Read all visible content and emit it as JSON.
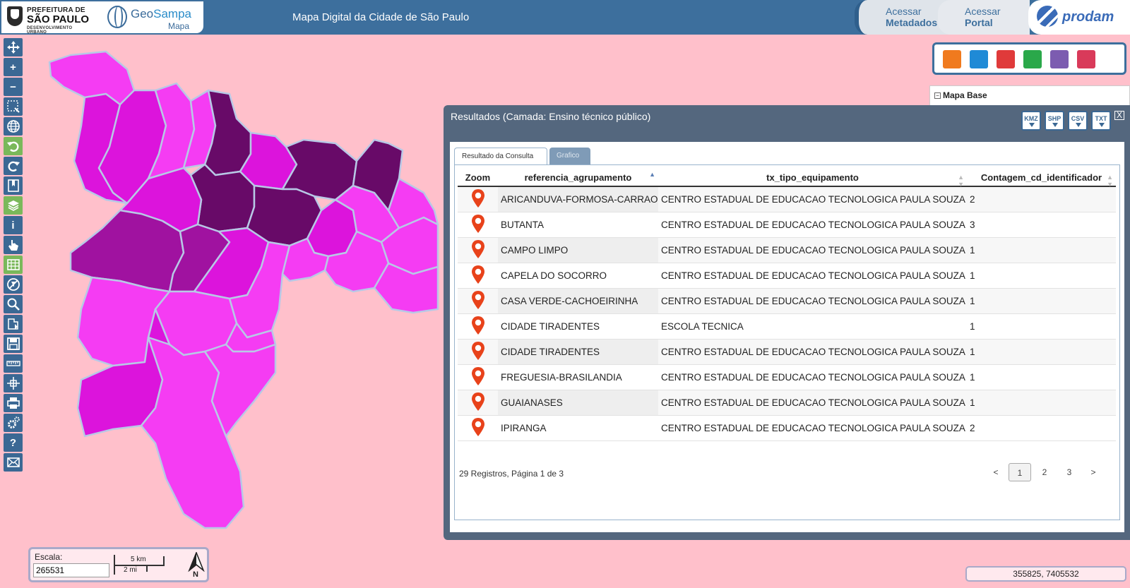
{
  "header": {
    "pref_line1": "PREFEITURA DE",
    "pref_line2": "SÃO PAULO",
    "pref_line3": "DESENVOLVIMENTO URBANO",
    "geo_name_a": "Geo",
    "geo_name_b": "Sampa",
    "geo_sub": "Mapa",
    "app_title": "Mapa Digital da Cidade de São Paulo",
    "metadados_line1": "Acessar",
    "metadados_line2": "Metadados",
    "portal_line1": "Acessar",
    "portal_line2": "Portal",
    "prodam": "prodam"
  },
  "toolbar": [
    "pan-icon",
    "zoom-in-icon",
    "zoom-out-icon",
    "zoom-box-icon",
    "globe-icon",
    "undo-icon",
    "redo-icon",
    "bookmark-icon",
    "layers-icon",
    "info-icon",
    "touch-icon",
    "table-icon",
    "no-filter-icon",
    "search-icon",
    "export-map-icon",
    "save-icon",
    "measure-icon",
    "coordinate-icon",
    "print-icon",
    "settings-icon",
    "help-icon",
    "mail-icon"
  ],
  "icon_bar_colors": [
    "#f07a1e",
    "#1f8ad6",
    "#e03a3a",
    "#2aa84a",
    "#7c5cb0",
    "#d93a5a"
  ],
  "layers": {
    "root_label": "Mapa Base",
    "toggle": "−"
  },
  "results": {
    "title": "Resultados (Camada: Ensino técnico público)",
    "close": "X",
    "exports": [
      "KMZ",
      "SHP",
      "CSV",
      "TXT"
    ],
    "tabs": [
      "Resultado da Consulta",
      "Grafico"
    ],
    "columns": [
      "Zoom",
      "referencia_agrupamento",
      "tx_tipo_equipamento",
      "Contagem_cd_identificador"
    ],
    "rows": [
      [
        "ARICANDUVA-FORMOSA-CARRAO",
        "CENTRO ESTADUAL DE EDUCACAO TECNOLOGICA PAULA SOUZA",
        "2"
      ],
      [
        "BUTANTA",
        "CENTRO ESTADUAL DE EDUCACAO TECNOLOGICA PAULA SOUZA",
        "3"
      ],
      [
        "CAMPO LIMPO",
        "CENTRO ESTADUAL DE EDUCACAO TECNOLOGICA PAULA SOUZA",
        "1"
      ],
      [
        "CAPELA DO SOCORRO",
        "CENTRO ESTADUAL DE EDUCACAO TECNOLOGICA PAULA SOUZA",
        "1"
      ],
      [
        "CASA VERDE-CACHOEIRINHA",
        "CENTRO ESTADUAL DE EDUCACAO TECNOLOGICA PAULA SOUZA",
        "1"
      ],
      [
        "CIDADE TIRADENTES",
        "ESCOLA TECNICA",
        "1"
      ],
      [
        "CIDADE TIRADENTES",
        "CENTRO ESTADUAL DE EDUCACAO TECNOLOGICA PAULA SOUZA",
        "1"
      ],
      [
        "FREGUESIA-BRASILANDIA",
        "CENTRO ESTADUAL DE EDUCACAO TECNOLOGICA PAULA SOUZA",
        "1"
      ],
      [
        "GUAIANASES",
        "CENTRO ESTADUAL DE EDUCACAO TECNOLOGICA PAULA SOUZA",
        "1"
      ],
      [
        "IPIRANGA",
        "CENTRO ESTADUAL DE EDUCACAO TECNOLOGICA PAULA SOUZA",
        "2"
      ]
    ],
    "footer": "29 Registros, Página 1 de 3",
    "pager": [
      "<",
      "1",
      "2",
      "3",
      ">"
    ]
  },
  "scale": {
    "label": "Escala:",
    "value": "265531",
    "km": "5 km",
    "mi": "2 mi",
    "north": "N"
  },
  "coords": "355825, 7405532",
  "map_colors": {
    "light": "#f53cf3",
    "mid": "#dc14dc",
    "dark": "#a012a0",
    "darker": "#680a68",
    "border": "#b8c8e6"
  }
}
